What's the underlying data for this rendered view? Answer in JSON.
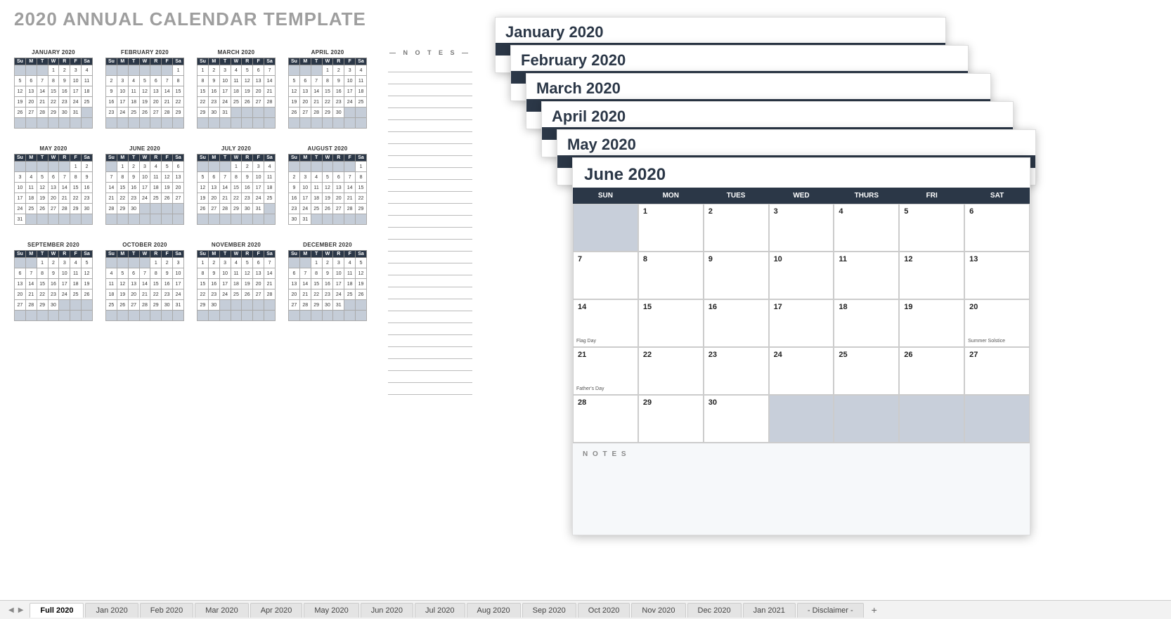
{
  "title": "2020 ANNUAL CALENDAR TEMPLATE",
  "notesLabel": "— N O T E S —",
  "dayAbbr": [
    "Su",
    "M",
    "T",
    "W",
    "R",
    "F",
    "Sa"
  ],
  "dayFull": [
    "SUN",
    "MON",
    "TUES",
    "WED",
    "THURS",
    "FRI",
    "SAT"
  ],
  "miniMonths": [
    {
      "name": "JANUARY 2020",
      "start": 3,
      "days": 31
    },
    {
      "name": "FEBRUARY 2020",
      "start": 6,
      "days": 29
    },
    {
      "name": "MARCH 2020",
      "start": 0,
      "days": 31
    },
    {
      "name": "APRIL 2020",
      "start": 3,
      "days": 30
    },
    {
      "name": "MAY 2020",
      "start": 5,
      "days": 31
    },
    {
      "name": "JUNE 2020",
      "start": 1,
      "days": 30
    },
    {
      "name": "JULY 2020",
      "start": 3,
      "days": 31
    },
    {
      "name": "AUGUST 2020",
      "start": 6,
      "days": 31
    },
    {
      "name": "SEPTEMBER 2020",
      "start": 2,
      "days": 30
    },
    {
      "name": "OCTOBER 2020",
      "start": 4,
      "days": 31
    },
    {
      "name": "NOVEMBER 2020",
      "start": 0,
      "days": 30
    },
    {
      "name": "DECEMBER 2020",
      "start": 2,
      "days": 31
    }
  ],
  "stackSheets": [
    "January 2020",
    "February 2020",
    "March 2020",
    "April 2020",
    "May 2020"
  ],
  "june": {
    "title": "June 2020",
    "start": 1,
    "days": 30,
    "events": [
      {
        "day": 14,
        "label": "Flag Day"
      },
      {
        "day": 20,
        "label": "Summer Solstice"
      },
      {
        "day": 21,
        "label": "Father's Day"
      }
    ],
    "notesLabel": "N O T E S"
  },
  "tabs": [
    "Full 2020",
    "Jan 2020",
    "Feb 2020",
    "Mar 2020",
    "Apr 2020",
    "May 2020",
    "Jun 2020",
    "Jul 2020",
    "Aug 2020",
    "Sep 2020",
    "Oct 2020",
    "Nov 2020",
    "Dec 2020",
    "Jan 2021",
    "- Disclaimer -"
  ],
  "activeTab": 0
}
